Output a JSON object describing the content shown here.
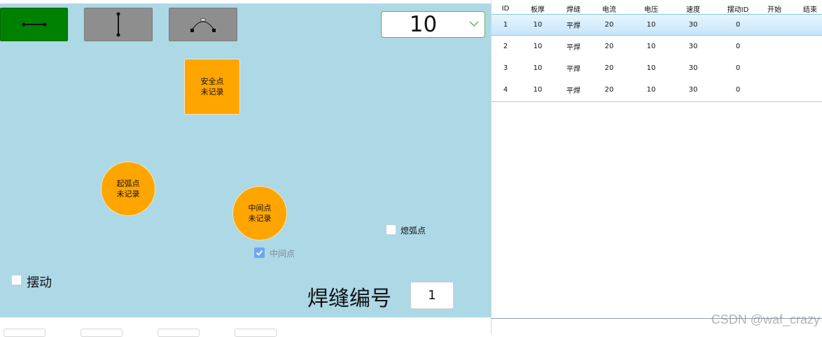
{
  "toolbar": {
    "buttons": [
      {
        "icon": "line-segment-icon",
        "color": "#008000"
      },
      {
        "icon": "vertical-segment-icon",
        "color": "#8e8e8e"
      },
      {
        "icon": "arc-icon",
        "color": "#8e8e8e"
      }
    ]
  },
  "combo": {
    "value": "10",
    "accent": "#5cb85c"
  },
  "points": {
    "safe": {
      "line1": "安全点",
      "line2": "未记录"
    },
    "arc_start": {
      "line1": "起弧点",
      "line2": "未记录"
    },
    "mid": {
      "line1": "中间点",
      "line2": "未记录"
    }
  },
  "checkboxes": {
    "extinguish": {
      "label": "熄弧点",
      "checked": false
    },
    "midpoint": {
      "label": "中间点",
      "checked": true
    },
    "swing": {
      "label": "摆动",
      "checked": false
    }
  },
  "seam": {
    "label": "焊缝编号",
    "value": "1"
  },
  "table": {
    "columns": [
      "ID",
      "板厚",
      "焊缝",
      "电流",
      "电压",
      "速度",
      "摆动ID",
      "开始",
      "结束"
    ],
    "rows": [
      [
        "1",
        "10",
        "平焊",
        "20",
        "10",
        "30",
        "0",
        "",
        ""
      ],
      [
        "2",
        "10",
        "平焊",
        "20",
        "10",
        "30",
        "0",
        "",
        ""
      ],
      [
        "3",
        "10",
        "平焊",
        "20",
        "10",
        "30",
        "0",
        "",
        ""
      ],
      [
        "4",
        "10",
        "平焊",
        "20",
        "10",
        "30",
        "0",
        "",
        ""
      ]
    ],
    "selected_row": 0
  },
  "watermark": "CSDN @waf_crazy",
  "colors": {
    "canvas": "#add8e6",
    "point": "#ffa500",
    "active_tool": "#008000"
  }
}
